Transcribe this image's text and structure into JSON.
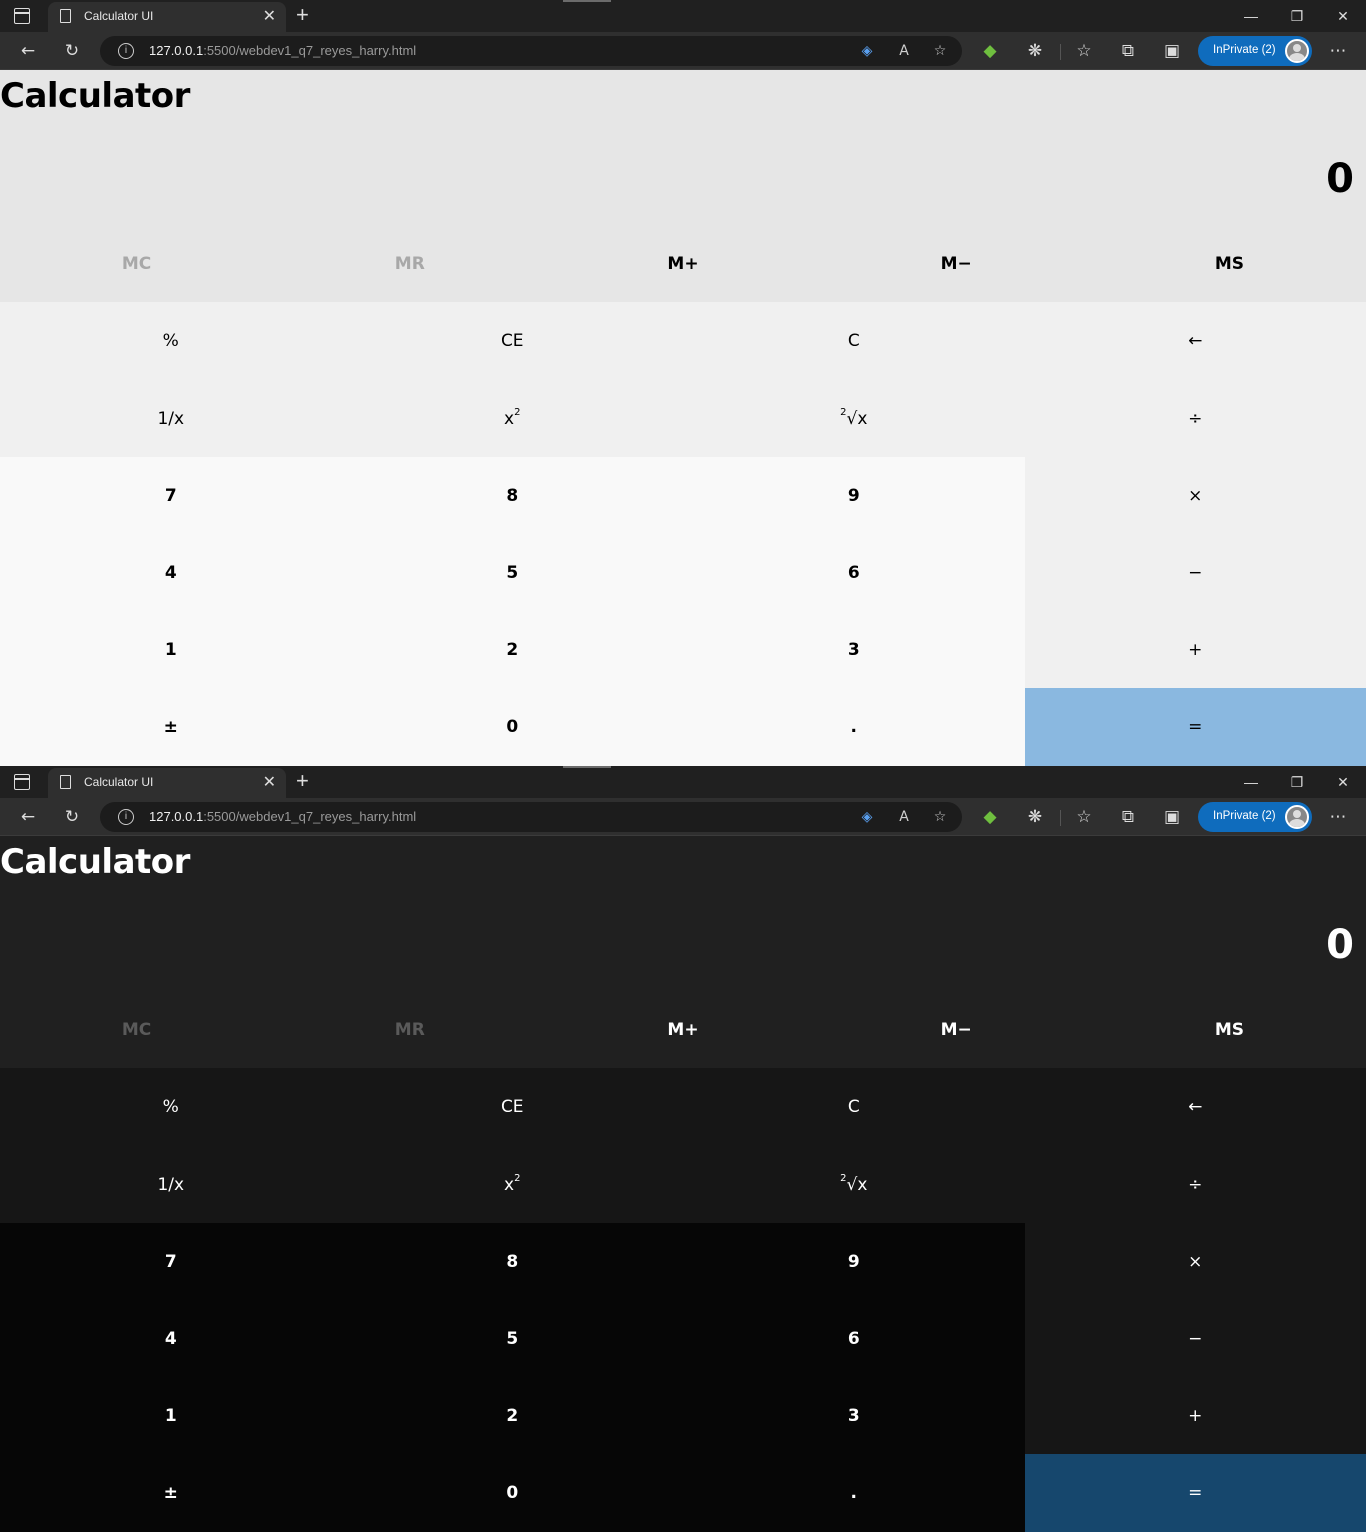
{
  "browser": {
    "tab_title": "Calculator UI",
    "tab_close": "✕",
    "new_tab": "+",
    "address_host": "127.0.0.1",
    "address_rest": ":5500/webdev1_q7_reyes_harry.html",
    "inprivate_label": "InPrivate (2)"
  },
  "calculator": {
    "title": "Calculator",
    "display": "0",
    "memory": [
      "MC",
      "MR",
      "M+",
      "M−",
      "MS"
    ],
    "memory_disabled": [
      true,
      true,
      false,
      false,
      false
    ],
    "keys": {
      "percent": "%",
      "ce": "CE",
      "c": "C",
      "backspace": "←",
      "reciprocal": "1/x",
      "square_base": "x",
      "square_exp": "2",
      "sqrt_index": "2",
      "sqrt_body": "√x",
      "divide": "÷",
      "d7": "7",
      "d8": "8",
      "d9": "9",
      "multiply": "×",
      "d4": "4",
      "d5": "5",
      "d6": "6",
      "subtract": "−",
      "d1": "1",
      "d2": "2",
      "d3": "3",
      "add": "+",
      "negate": "±",
      "d0": "0",
      "decimal": ".",
      "equals": "="
    }
  },
  "themes": [
    {
      "name": "light",
      "page_bg": "#e6e6e6",
      "equals_bg": "#8ab8e0"
    },
    {
      "name": "dark",
      "page_bg": "#202020",
      "equals_bg": "#16476d"
    }
  ]
}
